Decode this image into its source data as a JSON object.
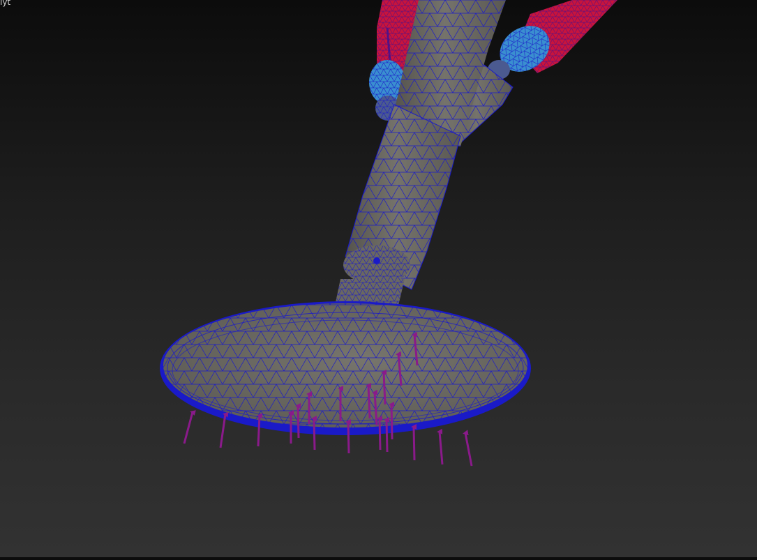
{
  "viewport": {
    "label": "lyt",
    "background_top": "#0c0c0c",
    "background_bottom": "#323232"
  },
  "colors": {
    "mesh_fill": "#6a6861",
    "mesh_fill_light": "#7b7970",
    "wire": "#1a1ac8",
    "red_part": "#c8143c",
    "cyan_part": "#3a8fd0",
    "force_arrow": "#8a1a8a"
  },
  "scene": {
    "force_arrow_count": 24
  }
}
